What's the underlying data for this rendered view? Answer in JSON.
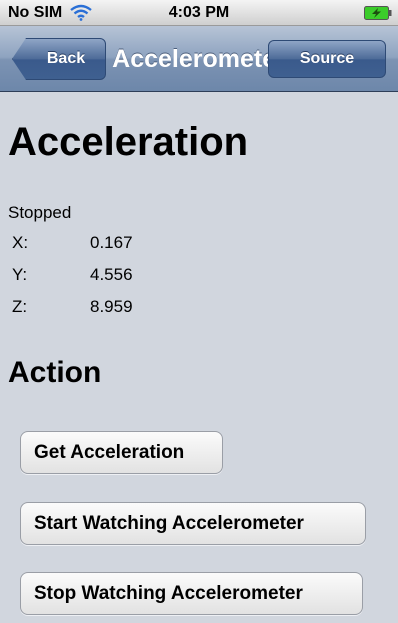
{
  "status_bar": {
    "carrier": "No SIM",
    "time": "4:03 PM",
    "wifi_icon": "wifi-icon",
    "battery_icon": "battery-charging-icon"
  },
  "nav_bar": {
    "back_label": "Back",
    "title": "Accelerometer",
    "source_label": "Source"
  },
  "main": {
    "heading": "Acceleration",
    "status": "Stopped",
    "axes": [
      {
        "label": "X:",
        "value": "0.167"
      },
      {
        "label": "Y:",
        "value": "4.556"
      },
      {
        "label": "Z:",
        "value": "8.959"
      }
    ],
    "action_heading": "Action",
    "buttons": [
      {
        "label": "Get Acceleration"
      },
      {
        "label": "Start Watching Accelerometer"
      },
      {
        "label": "Stop Watching Accelerometer"
      }
    ]
  },
  "colors": {
    "background": "#d1d6de",
    "nav_bar": "#8ea3c0",
    "nav_button": "#3f6090",
    "battery": "#3bcc2a"
  }
}
